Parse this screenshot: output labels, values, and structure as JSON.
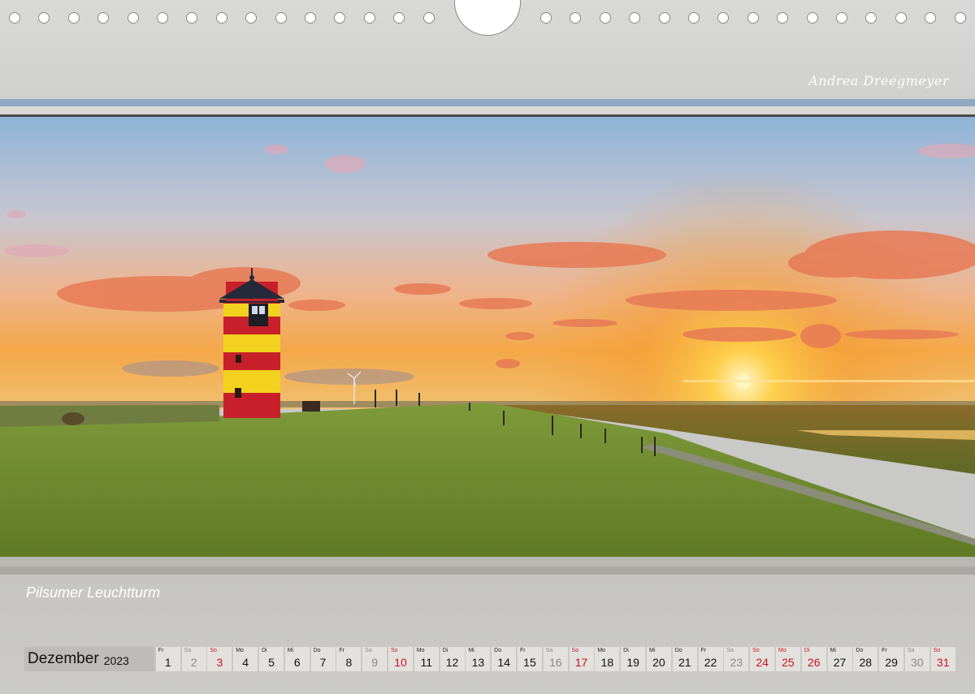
{
  "signature": "Andrea Dreegmeyer",
  "caption": "Pilsumer Leuchtturm",
  "calendar": {
    "month": "Dezember",
    "year": "2023",
    "days": [
      {
        "wd": "Fr",
        "n": "1",
        "type": ""
      },
      {
        "wd": "Sa",
        "n": "2",
        "type": "sa"
      },
      {
        "wd": "So",
        "n": "3",
        "type": "red"
      },
      {
        "wd": "Mo",
        "n": "4",
        "type": ""
      },
      {
        "wd": "Di",
        "n": "5",
        "type": ""
      },
      {
        "wd": "Mi",
        "n": "6",
        "type": ""
      },
      {
        "wd": "Do",
        "n": "7",
        "type": ""
      },
      {
        "wd": "Fr",
        "n": "8",
        "type": ""
      },
      {
        "wd": "Sa",
        "n": "9",
        "type": "sa"
      },
      {
        "wd": "So",
        "n": "10",
        "type": "red"
      },
      {
        "wd": "Mo",
        "n": "11",
        "type": ""
      },
      {
        "wd": "Di",
        "n": "12",
        "type": ""
      },
      {
        "wd": "Mi",
        "n": "13",
        "type": ""
      },
      {
        "wd": "Do",
        "n": "14",
        "type": ""
      },
      {
        "wd": "Fr",
        "n": "15",
        "type": ""
      },
      {
        "wd": "Sa",
        "n": "16",
        "type": "sa"
      },
      {
        "wd": "So",
        "n": "17",
        "type": "red"
      },
      {
        "wd": "Mo",
        "n": "18",
        "type": ""
      },
      {
        "wd": "Di",
        "n": "19",
        "type": ""
      },
      {
        "wd": "Mi",
        "n": "20",
        "type": ""
      },
      {
        "wd": "Do",
        "n": "21",
        "type": ""
      },
      {
        "wd": "Fr",
        "n": "22",
        "type": ""
      },
      {
        "wd": "Sa",
        "n": "23",
        "type": "sa"
      },
      {
        "wd": "So",
        "n": "24",
        "type": "red"
      },
      {
        "wd": "Mo",
        "n": "25",
        "type": "red"
      },
      {
        "wd": "Di",
        "n": "26",
        "type": "red"
      },
      {
        "wd": "Mi",
        "n": "27",
        "type": ""
      },
      {
        "wd": "Do",
        "n": "28",
        "type": ""
      },
      {
        "wd": "Fr",
        "n": "29",
        "type": ""
      },
      {
        "wd": "Sa",
        "n": "30",
        "type": "sa"
      },
      {
        "wd": "So",
        "n": "31",
        "type": "red"
      }
    ]
  },
  "photo": {
    "subject": "lighthouse-sunset",
    "colors": {
      "sky_top": "#8fb4d8",
      "sky_mid": "#e9b898",
      "sky_horizon": "#f6a23a",
      "grass": "#6f8a2e",
      "sun": "#fff6c0",
      "tower_red": "#c8202a",
      "tower_yellow": "#f2d21e"
    }
  }
}
